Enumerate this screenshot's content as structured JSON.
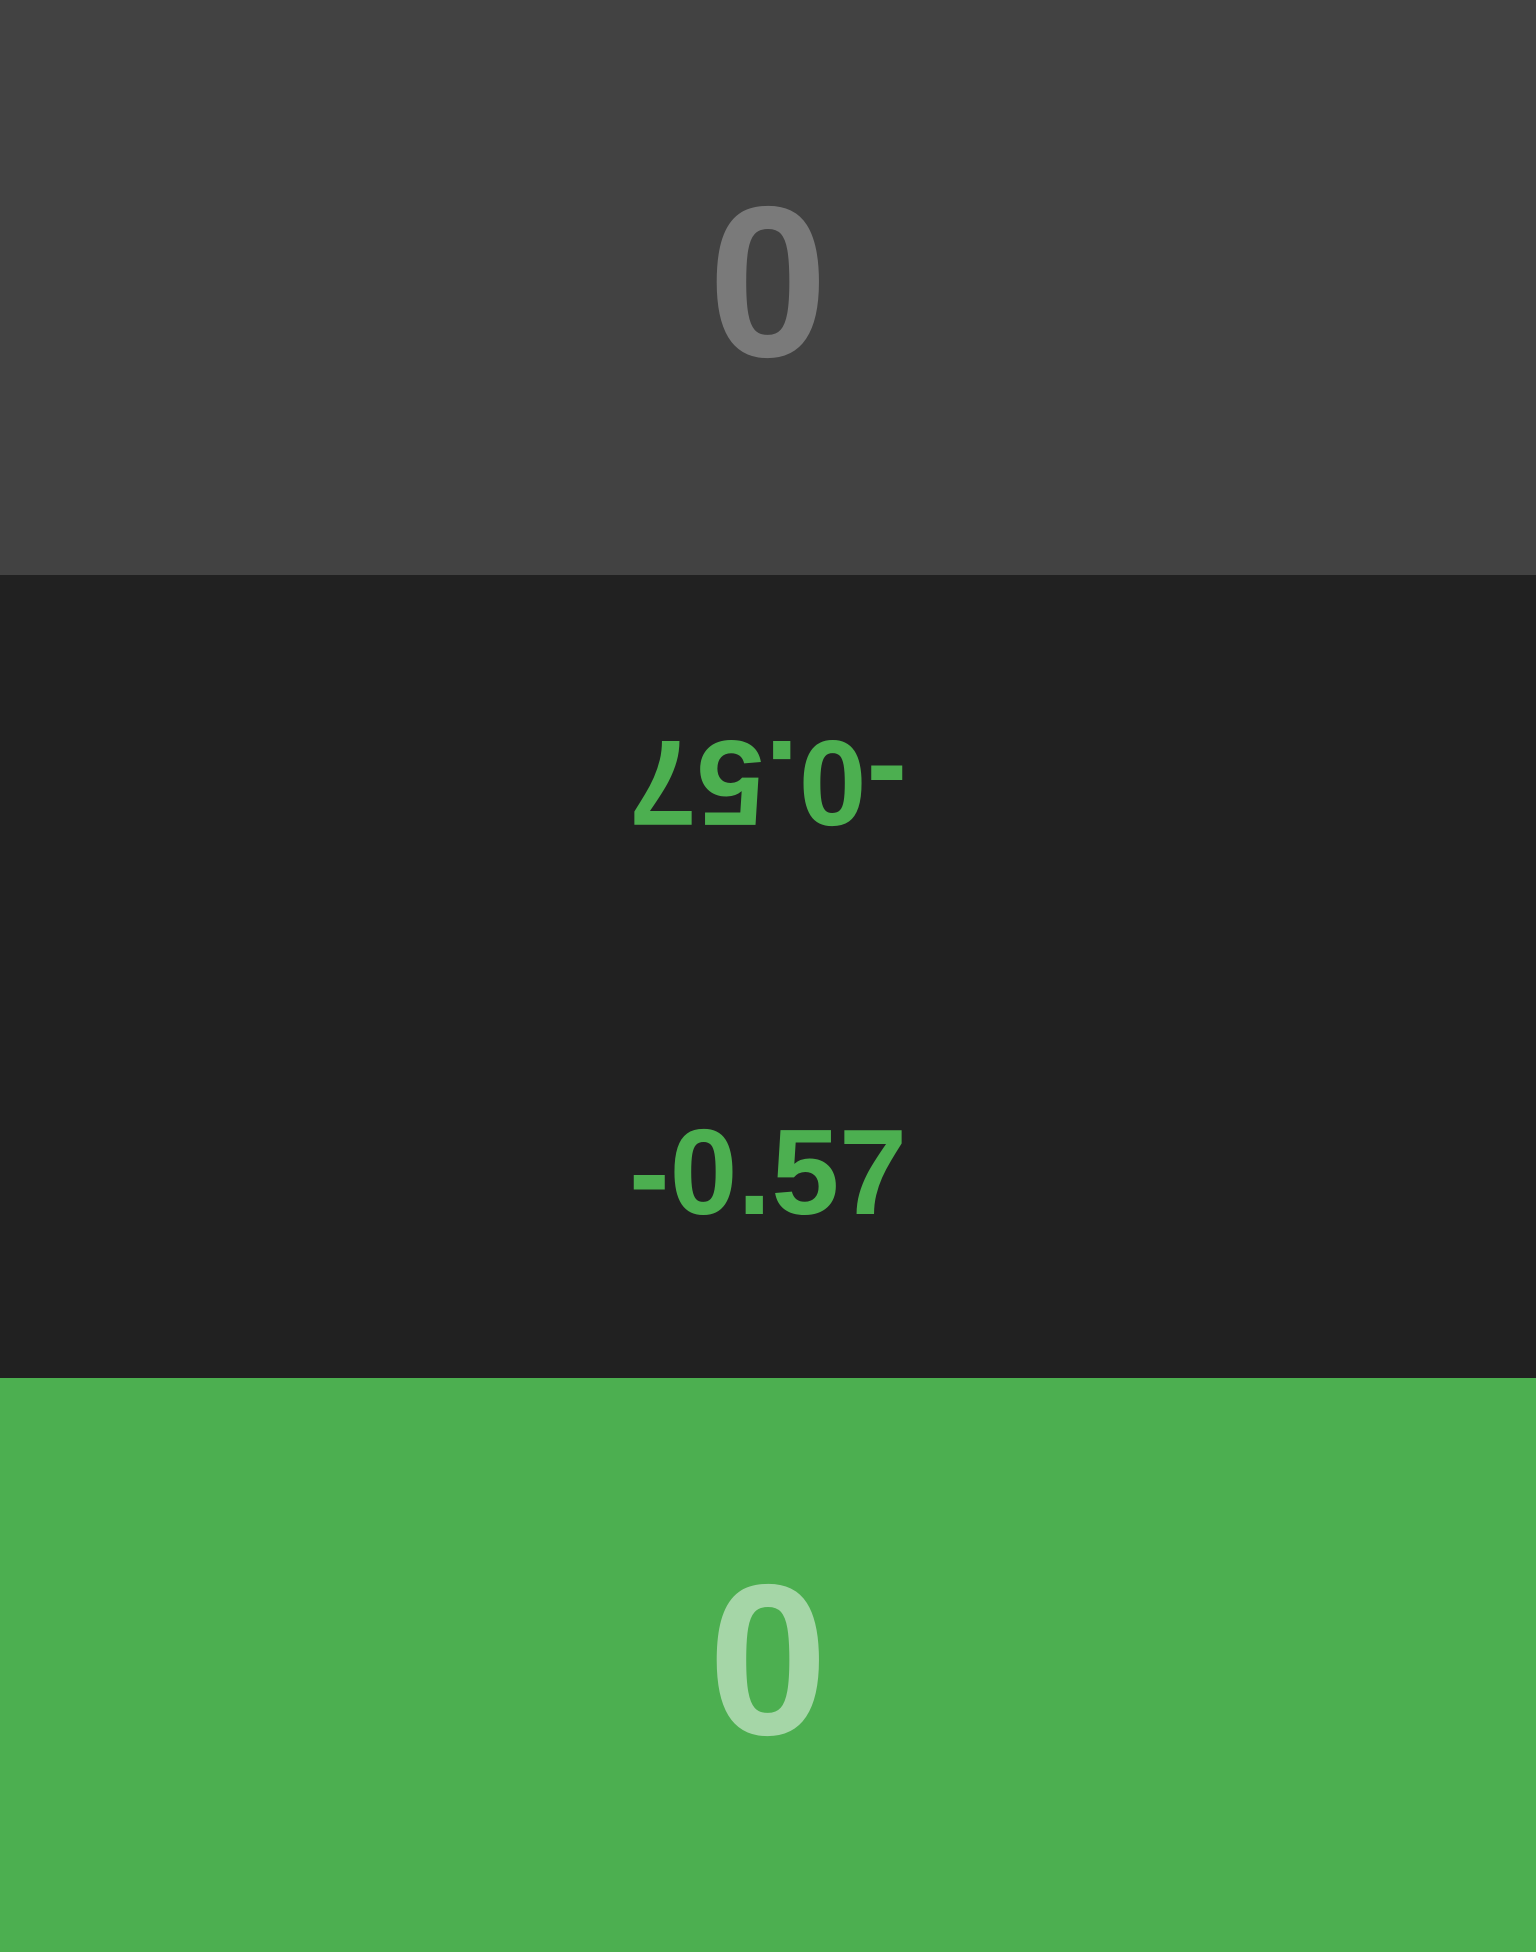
{
  "top_player": {
    "score": "0",
    "background_color": "#424242",
    "score_color": "#7a7a7a"
  },
  "center": {
    "difference_upside_down": "-0.57",
    "difference": "-0.57",
    "background_color": "#212121",
    "text_color": "#4caf50"
  },
  "bottom_player": {
    "score": "0",
    "background_color": "#4caf50",
    "score_color": "#a5d6a7"
  }
}
